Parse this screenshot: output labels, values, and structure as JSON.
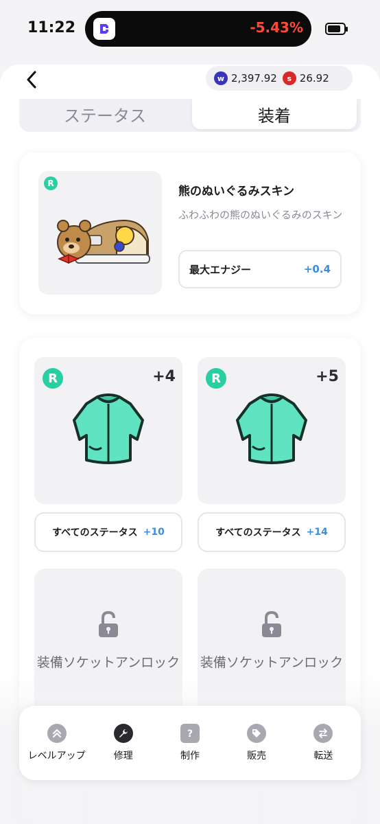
{
  "status_bar": {
    "time": "11:22",
    "change_percent": "-5.43%"
  },
  "header": {
    "balances": [
      {
        "icon": "w-coin-icon",
        "value": "2,397.92"
      },
      {
        "icon": "s-coin-icon",
        "value": "26.92"
      }
    ]
  },
  "tabs": {
    "status": "ステータス",
    "equip": "装着",
    "active": "equip"
  },
  "skin": {
    "rarity": "R",
    "name": "熊のぬいぐるみスキン",
    "description": "ふわふわの熊のぬいぐるみのスキン",
    "stat_label": "最大エナジー",
    "stat_value": "+0.4"
  },
  "slots": [
    {
      "rarity": "R",
      "level": "+4",
      "stat_label": "すべてのステータス",
      "stat_value": "+10"
    },
    {
      "rarity": "R",
      "level": "+5",
      "stat_label": "すべてのステータス",
      "stat_value": "+14"
    }
  ],
  "locked_slots": [
    {
      "label": "装備ソケットアンロック"
    },
    {
      "label": "装備ソケットアンロック"
    }
  ],
  "actions": [
    {
      "label": "レベルアップ",
      "icon": "level-up-icon"
    },
    {
      "label": "修理",
      "icon": "wrench-icon"
    },
    {
      "label": "制作",
      "icon": "mystery-box-icon"
    },
    {
      "label": "販売",
      "icon": "tag-icon"
    },
    {
      "label": "転送",
      "icon": "transfer-icon"
    }
  ],
  "colors": {
    "accent_blue": "#3e8ee0",
    "rarity_green": "#27cfa2",
    "negative_red": "#ff4a3a"
  }
}
